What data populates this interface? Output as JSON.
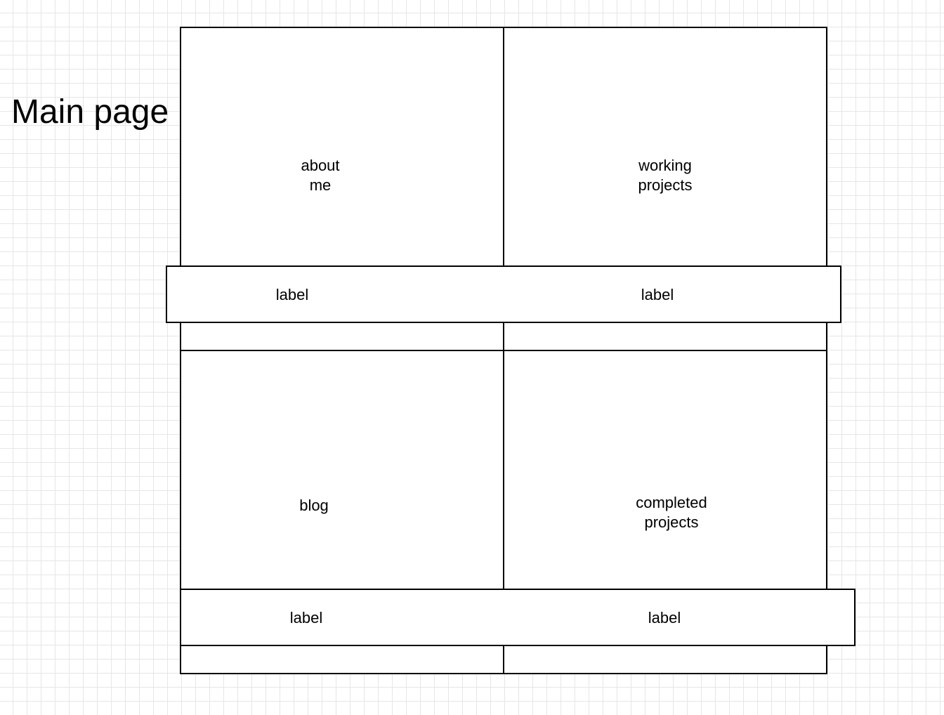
{
  "page": {
    "title": "Main page"
  },
  "panels": {
    "about": "about\nme",
    "working": "working\nprojects",
    "blog": "blog",
    "completed": "completed\nprojects"
  },
  "labels": {
    "top_left": "label",
    "top_right": "label",
    "bottom_left": "label",
    "bottom_right": "label"
  }
}
